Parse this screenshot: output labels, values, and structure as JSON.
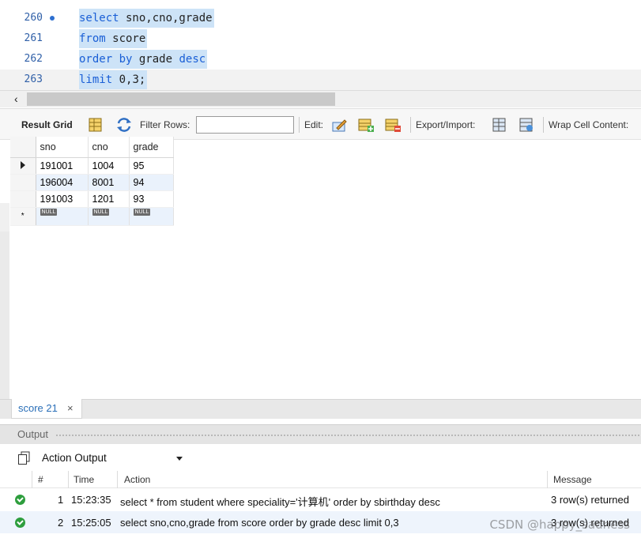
{
  "editor": {
    "lines": [
      {
        "num": "260",
        "has_marker": true,
        "parts": [
          {
            "t": "select",
            "c": "kw"
          },
          {
            "t": " sno,cno,grade",
            "c": ""
          }
        ]
      },
      {
        "num": "261",
        "has_marker": false,
        "parts": [
          {
            "t": "from",
            "c": "kw"
          },
          {
            "t": " score",
            "c": ""
          }
        ]
      },
      {
        "num": "262",
        "has_marker": false,
        "parts": [
          {
            "t": "order",
            "c": "kw"
          },
          {
            "t": " ",
            "c": ""
          },
          {
            "t": "by",
            "c": "kw"
          },
          {
            "t": " grade ",
            "c": ""
          },
          {
            "t": "desc",
            "c": "kw"
          }
        ]
      },
      {
        "num": "263",
        "has_marker": false,
        "current": true,
        "parts": [
          {
            "t": "limit",
            "c": "kw"
          },
          {
            "t": " 0,3;",
            "c": ""
          }
        ]
      }
    ]
  },
  "result_toolbar": {
    "result_grid_label": "Result Grid",
    "filter_rows_label": "Filter Rows:",
    "filter_value": "",
    "edit_label": "Edit:",
    "export_import_label": "Export/Import:",
    "wrap_cell_label": "Wrap Cell Content:"
  },
  "grid": {
    "columns": [
      "sno",
      "cno",
      "grade"
    ],
    "rows": [
      [
        "191001",
        "1004",
        "95"
      ],
      [
        "196004",
        "8001",
        "94"
      ],
      [
        "191003",
        "1201",
        "93"
      ]
    ],
    "null_label": "NULL",
    "new_row_marker": "*"
  },
  "tabs": [
    {
      "label": "score 21",
      "close": "×"
    }
  ],
  "output": {
    "title": "Output",
    "mode": "Action Output",
    "columns": {
      "num": "#",
      "time": "Time",
      "action": "Action",
      "message": "Message"
    },
    "rows": [
      {
        "num": "1",
        "time": "15:23:35",
        "action": "select * from student where speciality='计算机' order by sbirthday desc",
        "message": "3 row(s) returned"
      },
      {
        "num": "2",
        "time": "15:25:05",
        "action": "select sno,cno,grade from score order by grade desc limit 0,3",
        "message": "3 row(s) returned"
      }
    ]
  },
  "watermark": "CSDN @happy_sadness",
  "colors": {
    "keyword": "#1a5fd6",
    "selection": "#cde3f7",
    "ok": "#2e9e3e"
  }
}
